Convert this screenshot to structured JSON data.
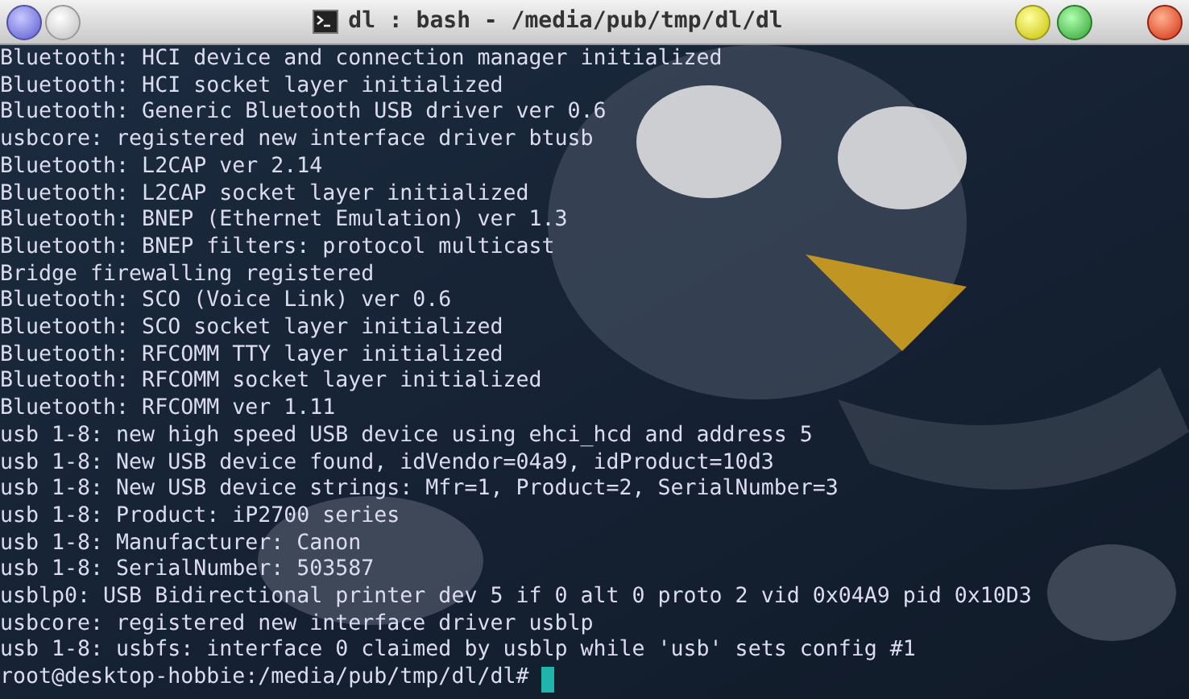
{
  "window": {
    "title": "dl : bash - /media/pub/tmp/dl/dl"
  },
  "terminal": {
    "lines": [
      "Bluetooth: HCI device and connection manager initialized",
      "Bluetooth: HCI socket layer initialized",
      "Bluetooth: Generic Bluetooth USB driver ver 0.6",
      "usbcore: registered new interface driver btusb",
      "Bluetooth: L2CAP ver 2.14",
      "Bluetooth: L2CAP socket layer initialized",
      "Bluetooth: BNEP (Ethernet Emulation) ver 1.3",
      "Bluetooth: BNEP filters: protocol multicast",
      "Bridge firewalling registered",
      "Bluetooth: SCO (Voice Link) ver 0.6",
      "Bluetooth: SCO socket layer initialized",
      "Bluetooth: RFCOMM TTY layer initialized",
      "Bluetooth: RFCOMM socket layer initialized",
      "Bluetooth: RFCOMM ver 1.11",
      "usb 1-8: new high speed USB device using ehci_hcd and address 5",
      "usb 1-8: New USB device found, idVendor=04a9, idProduct=10d3",
      "usb 1-8: New USB device strings: Mfr=1, Product=2, SerialNumber=3",
      "usb 1-8: Product: iP2700 series",
      "usb 1-8: Manufacturer: Canon",
      "usb 1-8: SerialNumber: 503587",
      "usblp0: USB Bidirectional printer dev 5 if 0 alt 0 proto 2 vid 0x04A9 pid 0x10D3",
      "usbcore: registered new interface driver usblp",
      "usb 1-8: usbfs: interface 0 claimed by usblp while 'usb' sets config #1"
    ],
    "prompt": "root@desktop-hobbie:/media/pub/tmp/dl/dl#"
  }
}
